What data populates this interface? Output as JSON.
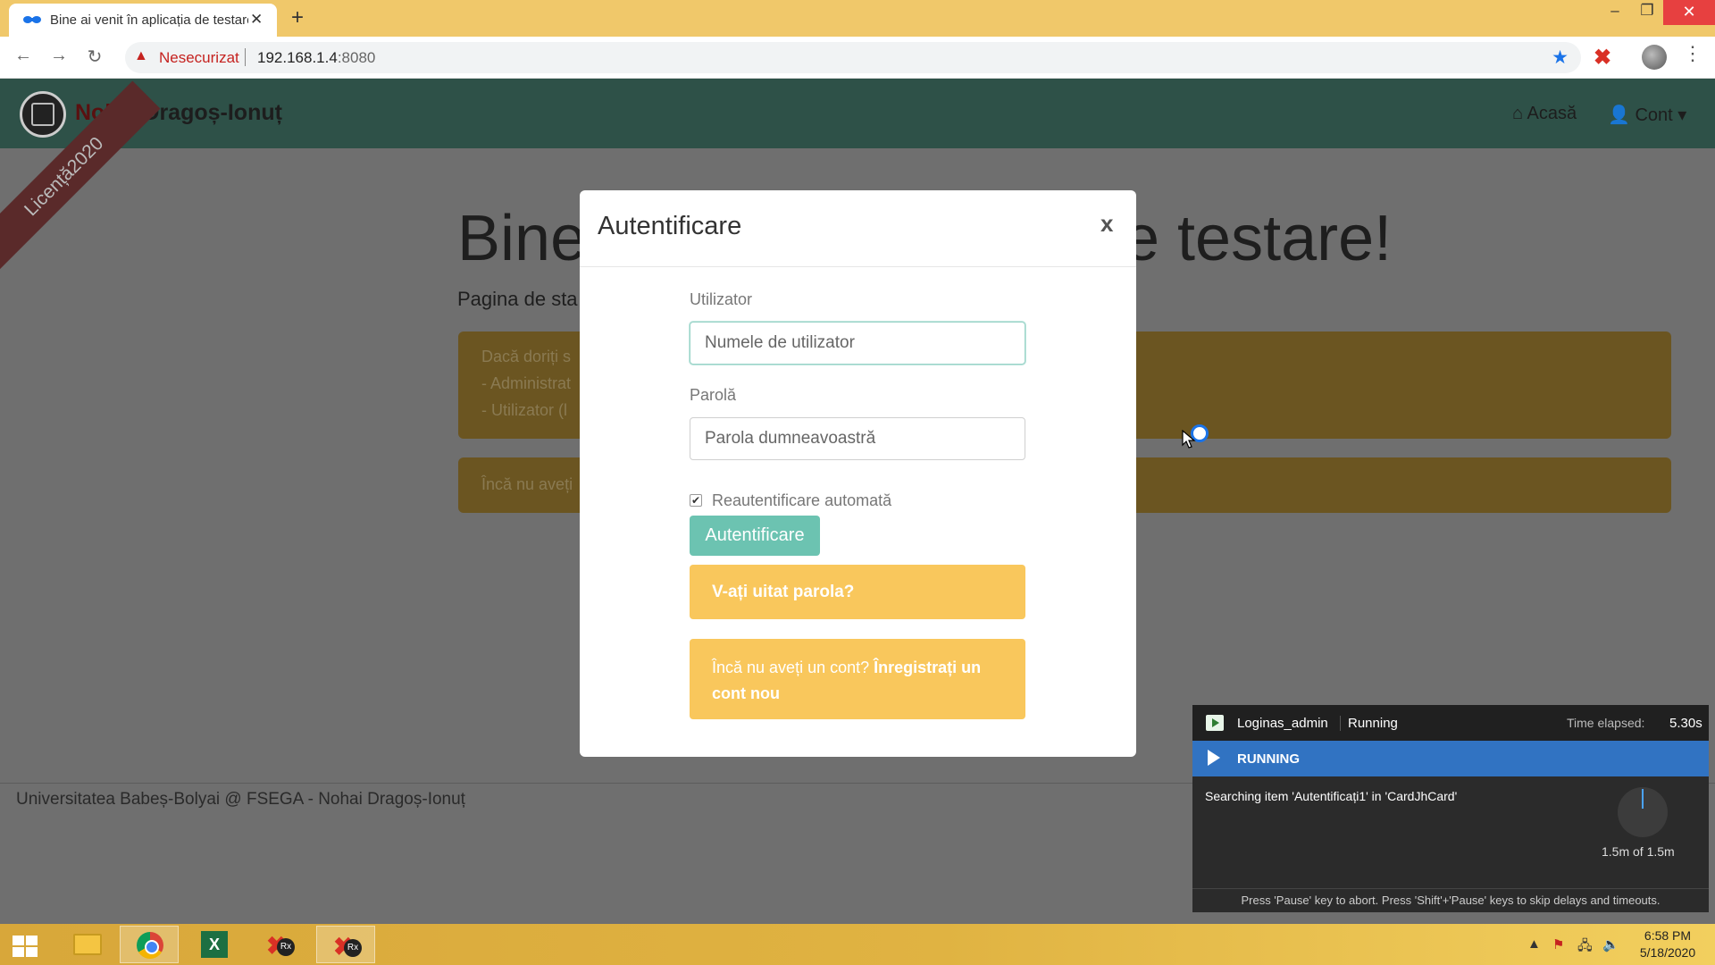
{
  "browser": {
    "tab_title": "Bine ai venit în aplicația de testare",
    "security_label": "Nesecurizat",
    "url_host": "192.168.1.4",
    "url_port": ":8080"
  },
  "site": {
    "brand_first": "Nohai",
    "brand_rest": " Dragoș-Ionuț",
    "ribbon": "Licență2020",
    "nav_home": "Acasă",
    "nav_account": "Cont",
    "hero_title_left": "Bine",
    "hero_title_right": "e testare!",
    "hero_subtitle": "Pagina de sta",
    "alert_lines": [
      "Dacă doriți s",
      "- Administrat",
      "- Utilizator (l"
    ],
    "alert2_text": "Încă nu aveți",
    "footer": "Universitatea Babeș-Bolyai @ FSEGA - Nohai Dragoș-Ionuț"
  },
  "modal": {
    "title": "Autentificare",
    "close": "x",
    "user_label": "Utilizator",
    "user_placeholder": "Numele de utilizator",
    "password_label": "Parolă",
    "password_placeholder": "Parola dumneavoastră",
    "remember_label": "Reautentificare automată",
    "remember_checked": true,
    "login_button": "Autentificare",
    "forgot_button": "V-ați uitat parola?",
    "register_prefix": "Încă nu aveți un cont?",
    "register_link": "Înregistrați un cont nou"
  },
  "runner": {
    "test_name": "Loginas_admin",
    "state": "Running",
    "elapsed_label": "Time elapsed:",
    "elapsed": "5.30s",
    "status": "RUNNING",
    "message": "Searching item 'Autentificați1' in 'CardJhCard'",
    "timeout": "1.5m of 1.5m",
    "footer": "Press 'Pause' key to abort. Press 'Shift'+'Pause' keys to skip delays and timeouts."
  },
  "taskbar": {
    "clock_time": "6:58 PM",
    "clock_date": "5/18/2020"
  }
}
